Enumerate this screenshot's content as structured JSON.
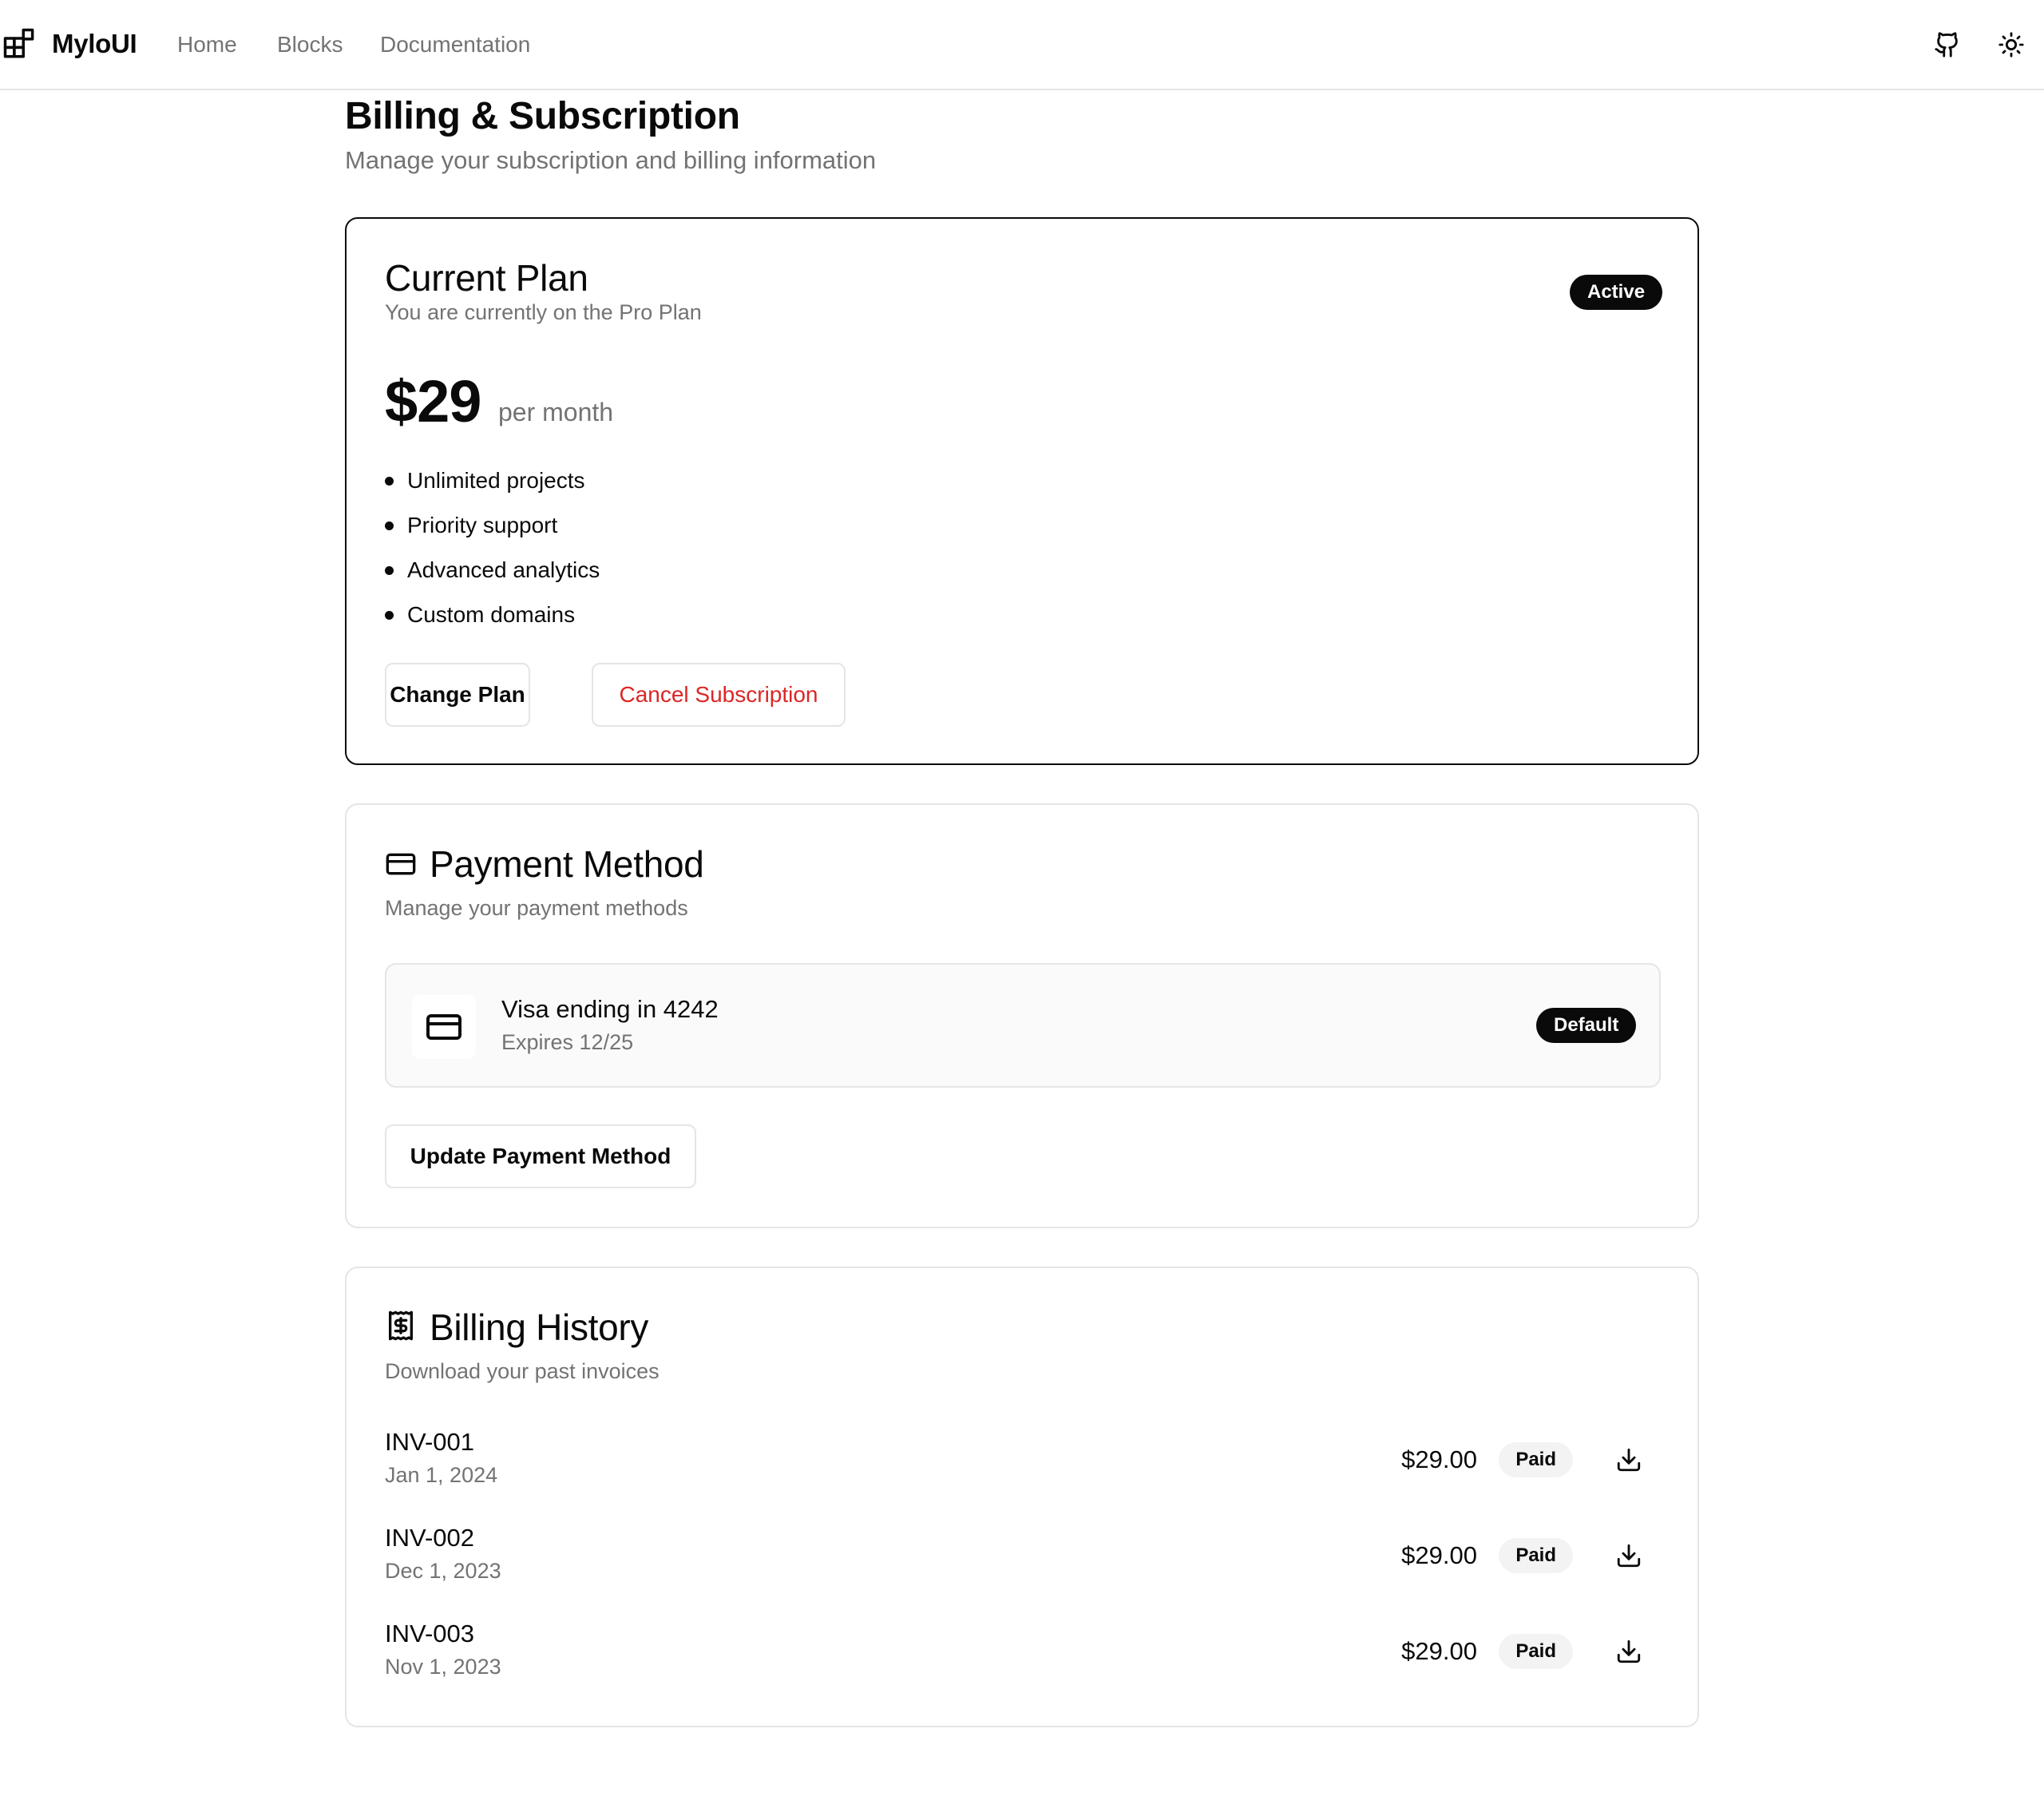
{
  "nav": {
    "brand": "MyloUI",
    "links": [
      "Home",
      "Blocks",
      "Documentation"
    ],
    "icons": [
      "github-icon",
      "sun-icon"
    ]
  },
  "page": {
    "title": "Billing & Subscription",
    "subtitle": "Manage your subscription and billing information"
  },
  "plan": {
    "title": "Current Plan",
    "description": "You are currently on the Pro Plan",
    "status": "Active",
    "price": "$29",
    "period": "per month",
    "features": [
      "Unlimited projects",
      "Priority support",
      "Advanced analytics",
      "Custom domains"
    ],
    "change_label": "Change Plan",
    "cancel_label": "Cancel Subscription"
  },
  "payment": {
    "title": "Payment Method",
    "description": "Manage your payment methods",
    "icon": "credit-card-icon",
    "card_name": "Visa ending in 4242",
    "card_expiry": "Expires 12/25",
    "card_badge": "Default",
    "update_label": "Update Payment Method"
  },
  "history": {
    "title": "Billing History",
    "description": "Download your past invoices",
    "icon": "receipt-icon",
    "invoices": [
      {
        "id": "INV-001",
        "date": "Jan 1, 2024",
        "amount": "$29.00",
        "status": "Paid"
      },
      {
        "id": "INV-002",
        "date": "Dec 1, 2023",
        "amount": "$29.00",
        "status": "Paid"
      },
      {
        "id": "INV-003",
        "date": "Nov 1, 2023",
        "amount": "$29.00",
        "status": "Paid"
      }
    ]
  },
  "colors": {
    "text": "#0a0a0a",
    "muted": "#737373",
    "border": "#e5e5e5",
    "danger": "#dc2626"
  }
}
